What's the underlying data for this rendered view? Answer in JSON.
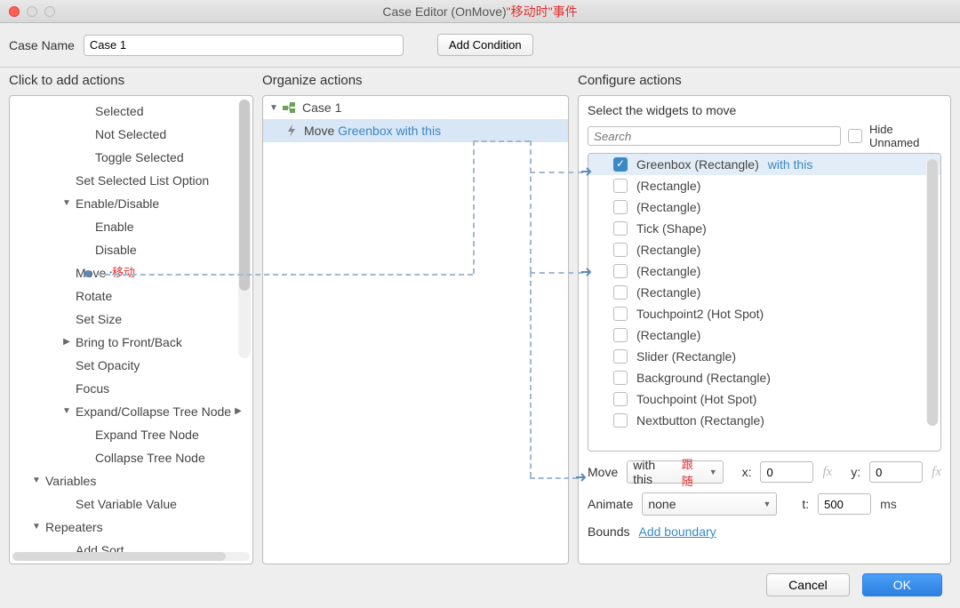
{
  "title": {
    "main": "Case Editor (OnMove)",
    "annot": "\"移动时\"事件"
  },
  "header": {
    "caseNameLabel": "Case Name",
    "caseNameValue": "Case 1",
    "addCondition": "Add Condition"
  },
  "columns": {
    "c1": "Click to add actions",
    "c2": "Organize actions",
    "c3": "Configure actions"
  },
  "actionsTree": [
    {
      "indent": 3,
      "arrow": "",
      "label": "Selected"
    },
    {
      "indent": 3,
      "arrow": "",
      "label": "Not Selected"
    },
    {
      "indent": 3,
      "arrow": "",
      "label": "Toggle Selected"
    },
    {
      "indent": 2,
      "arrow": "",
      "label": "Set Selected List Option"
    },
    {
      "indent": 2,
      "arrow": "▼",
      "label": "Enable/Disable"
    },
    {
      "indent": 3,
      "arrow": "",
      "label": "Enable"
    },
    {
      "indent": 3,
      "arrow": "",
      "label": "Disable"
    },
    {
      "indent": 2,
      "arrow": "",
      "label": "Move",
      "annot": "移动",
      "isMove": true
    },
    {
      "indent": 2,
      "arrow": "",
      "label": "Rotate"
    },
    {
      "indent": 2,
      "arrow": "",
      "label": "Set Size"
    },
    {
      "indent": 2,
      "arrow": "▶",
      "label": "Bring to Front/Back"
    },
    {
      "indent": 2,
      "arrow": "",
      "label": "Set Opacity"
    },
    {
      "indent": 2,
      "arrow": "",
      "label": "Focus"
    },
    {
      "indent": 2,
      "arrow": "▼",
      "label": "Expand/Collapse Tree Node",
      "trail": "▶"
    },
    {
      "indent": 3,
      "arrow": "",
      "label": "Expand Tree Node"
    },
    {
      "indent": 3,
      "arrow": "",
      "label": "Collapse Tree Node"
    },
    {
      "indent": 1,
      "arrow": "▼",
      "label": "Variables"
    },
    {
      "indent": 2,
      "arrow": "",
      "label": "Set Variable Value"
    },
    {
      "indent": 1,
      "arrow": "▼",
      "label": "Repeaters"
    },
    {
      "indent": 2,
      "arrow": "",
      "label": "Add Sort"
    }
  ],
  "organize": {
    "case": "Case 1",
    "rowVerb": "Move",
    "rowTarget": "Greenbox with this"
  },
  "configure": {
    "title": "Select the widgets to move",
    "searchPlaceholder": "Search",
    "hideUnnamed": "Hide Unnamed",
    "widgets": [
      {
        "checked": true,
        "name": "Greenbox (Rectangle)",
        "suffix": "with this",
        "sel": true
      },
      {
        "checked": false,
        "name": "(Rectangle)"
      },
      {
        "checked": false,
        "name": "(Rectangle)"
      },
      {
        "checked": false,
        "name": "Tick (Shape)"
      },
      {
        "checked": false,
        "name": "(Rectangle)"
      },
      {
        "checked": false,
        "name": "(Rectangle)"
      },
      {
        "checked": false,
        "name": "(Rectangle)"
      },
      {
        "checked": false,
        "name": "Touchpoint2 (Hot Spot)"
      },
      {
        "checked": false,
        "name": "(Rectangle)"
      },
      {
        "checked": false,
        "name": "Slider (Rectangle)"
      },
      {
        "checked": false,
        "name": "Background (Rectangle)"
      },
      {
        "checked": false,
        "name": "Touchpoint (Hot Spot)"
      },
      {
        "checked": false,
        "name": "Nextbutton (Rectangle)"
      }
    ],
    "moveLabel": "Move",
    "moveMode": "with this",
    "moveModeAnnot": "跟随",
    "xLabel": "x:",
    "xVal": "0",
    "yLabel": "y:",
    "yVal": "0",
    "fx": "fx",
    "animateLabel": "Animate",
    "animateMode": "none",
    "tLabel": "t:",
    "tVal": "500",
    "tUnit": "ms",
    "boundsLabel": "Bounds",
    "boundsLink": "Add boundary"
  },
  "footer": {
    "cancel": "Cancel",
    "ok": "OK"
  }
}
